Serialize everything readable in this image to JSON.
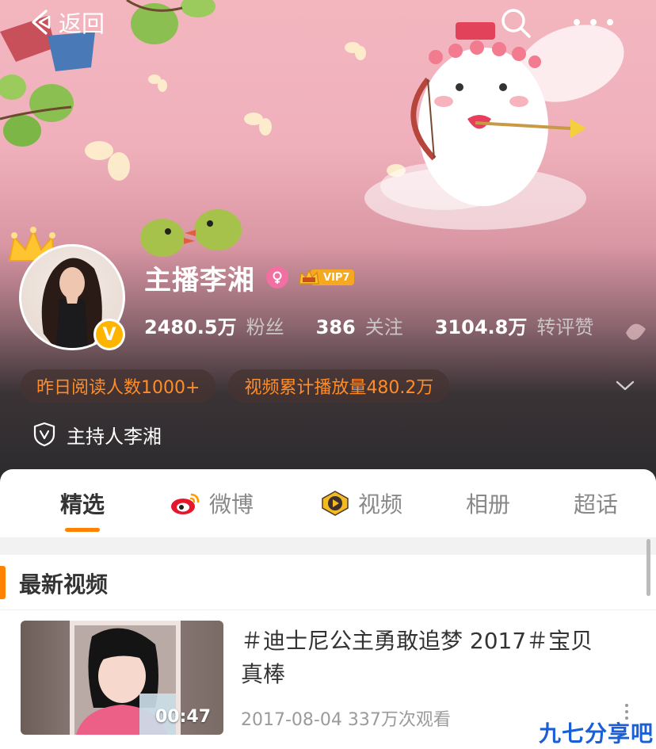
{
  "nav": {
    "back_label": "返回",
    "back_icon": "back-arrow-icon",
    "search_icon": "search-icon",
    "more_icon": "more-dots-icon"
  },
  "profile": {
    "name": "主播李湘",
    "gender_icon": "female-icon",
    "vip_label": "VIP7",
    "verified_icon": "verified-v-icon",
    "stats": [
      {
        "value": "2480.5万",
        "label": "粉丝"
      },
      {
        "value": "386",
        "label": "关注"
      },
      {
        "value": "3104.8万",
        "label": "转评赞"
      }
    ],
    "highlights": [
      "昨日阅读人数1000+",
      "视频累计播放量480.2万"
    ],
    "certification": "主持人李湘"
  },
  "tabs": [
    {
      "label": "精选",
      "active": true
    },
    {
      "label": "微博",
      "icon": "weibo-icon"
    },
    {
      "label": "视频",
      "icon": "video-play-icon"
    },
    {
      "label": "相册"
    },
    {
      "label": "超话"
    }
  ],
  "section": {
    "title": "最新视频"
  },
  "video": {
    "title": "＃迪士尼公主勇敢追梦 2017＃宝贝真棒",
    "duration": "00:47",
    "date": "2017-08-04",
    "views": "337万次观看"
  },
  "watermark": "九七分享吧",
  "colors": {
    "accent": "#ff8200",
    "highlight_text": "#ff8c28",
    "vip": "#f6a821",
    "verified": "#ffb400"
  }
}
